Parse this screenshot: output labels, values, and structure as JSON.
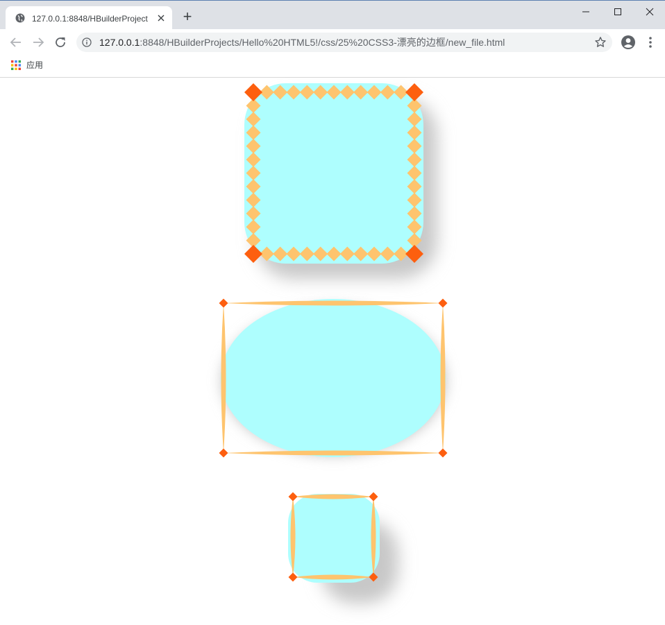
{
  "browser": {
    "tab": {
      "title": "127.0.0.1:8848/HBuilderProject",
      "favicon": "globe-icon",
      "close_icon": "close-icon"
    },
    "new_tab_label": "+",
    "window_controls": [
      "minimize-icon",
      "maximize-icon",
      "close-icon"
    ],
    "url": {
      "host": "127.0.0.1",
      "rest": ":8848/HBuilderProjects/Hello%20HTML5!/css/25%20CSS3-漂亮的边框/new_file.html"
    },
    "bookmarks": [
      {
        "label": "应用",
        "icon": "apps-grid-icon"
      }
    ]
  },
  "colors": {
    "box_fill": "#aefefe",
    "diamond_light": "#fec46e",
    "diamond_dark": "#fd5f0f",
    "shadow": "#c8c8c8",
    "tabstrip": "#dee1e6"
  }
}
